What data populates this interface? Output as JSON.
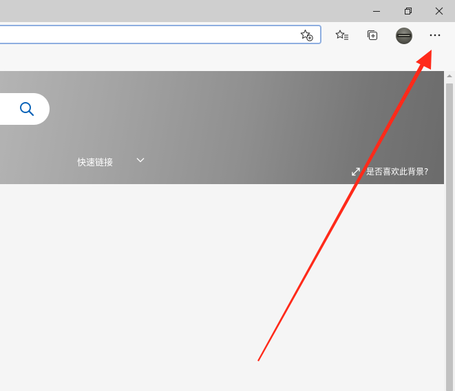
{
  "window": {
    "minimize_icon": "minimize-icon",
    "restore_icon": "restore-icon",
    "close_icon": "close-icon"
  },
  "toolbar": {
    "address_value": "",
    "address_placeholder": "",
    "add_favorite_icon": "star-add-icon",
    "favorites_icon": "favorites-list-icon",
    "collections_icon": "collections-icon",
    "profile_icon": "avatar",
    "menu_icon": "more-dots-icon"
  },
  "hero": {
    "search_icon": "search-icon",
    "quick_links_label": "快速链接",
    "background_like_label": "是否喜欢此背景?"
  },
  "colors": {
    "titlebar": "#cfcfcf",
    "toolbar": "#f7f7f7",
    "address_border": "#8eaee0",
    "search_icon": "#0a63b8",
    "annotation_arrow": "#ff2a1a"
  }
}
